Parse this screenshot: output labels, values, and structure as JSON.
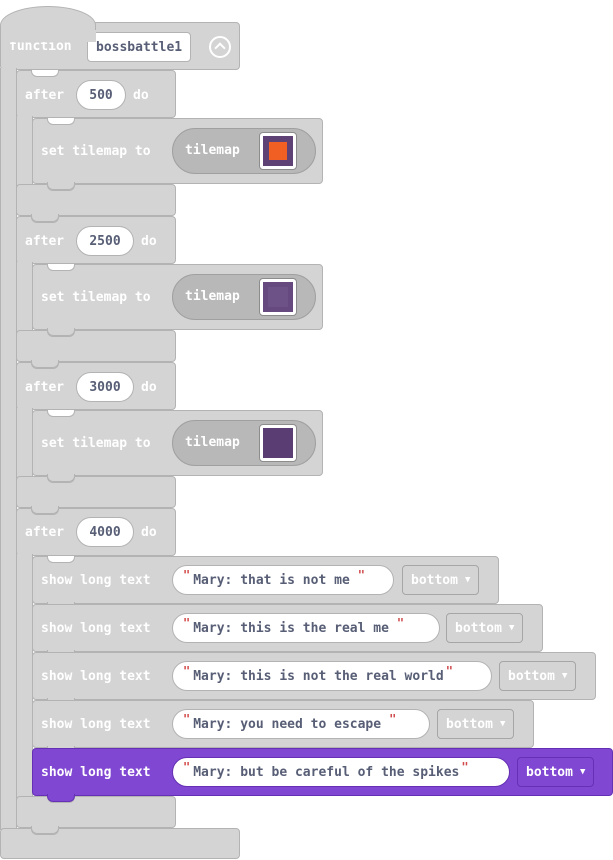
{
  "function_block": {
    "keyword": "function",
    "name": "bossbattle1"
  },
  "after_label": "after",
  "do_label": "do",
  "set_tilemap_label": "set tilemap to",
  "tilemap_label": "tilemap",
  "show_long_text_label": "show long text",
  "after_blocks": [
    {
      "delay": "500",
      "thumb_fill": "#5e4175",
      "thumb_accent": "#f15f22"
    },
    {
      "delay": "2500",
      "thumb_fill": "#65497f",
      "thumb_accent": "#6d5287"
    },
    {
      "delay": "3000",
      "thumb_fill": "#5a3d73",
      "thumb_accent": ""
    },
    {
      "delay": "4000"
    }
  ],
  "show_texts": [
    {
      "text": "Mary: that is not me",
      "position": "bottom"
    },
    {
      "text": "Mary: this is the real me",
      "position": "bottom"
    },
    {
      "text": "Mary: this is not the real world",
      "position": "bottom"
    },
    {
      "text": "Mary: you need to escape",
      "position": "bottom"
    },
    {
      "text": "Mary: but be careful of the spikes",
      "position": "bottom",
      "selected": true
    }
  ],
  "colors": {
    "block_gray": "#d4d4d4",
    "highlight_purple": "#8047d3",
    "pill_gray": "#b8b8b8"
  },
  "icons": {
    "collapse": "chevron-up-circle-icon",
    "dropdown": "caret-down-icon"
  }
}
